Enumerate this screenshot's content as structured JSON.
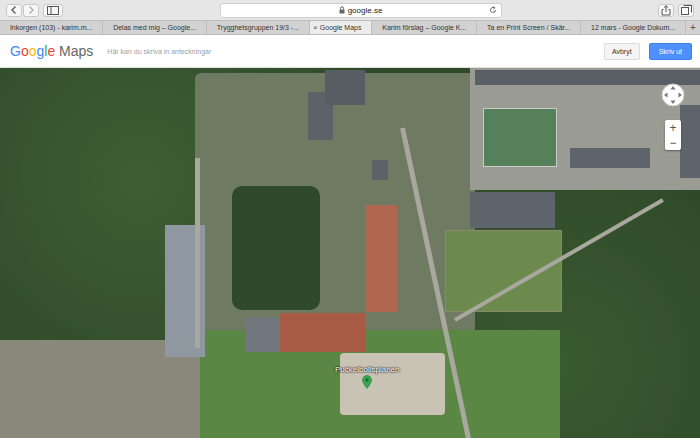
{
  "browser": {
    "url": "google.se",
    "secure": true
  },
  "tabs": [
    {
      "label": "Inkorgen (103) - karim.m...",
      "selected": false
    },
    {
      "label": "Delas med mig – Google...",
      "selected": false
    },
    {
      "label": "Trygghetsgruppen 19/3 -...",
      "selected": false
    },
    {
      "label": "Google Maps",
      "selected": true
    },
    {
      "label": "Karim förslag – Google K...",
      "selected": false
    },
    {
      "label": "Ta en Print Screen / Skär...",
      "selected": false
    },
    {
      "label": "12 mars - Google Dokum...",
      "selected": false
    }
  ],
  "tab_close": "×",
  "new_tab": "+",
  "maps_header": {
    "logo": "Google Maps",
    "note_placeholder": "Här kan du skriva in anteckningar",
    "buttons": [
      {
        "label": "Avbryt",
        "kind": "secondary"
      },
      {
        "label": "Skriv ut",
        "kind": "primary"
      }
    ]
  },
  "map": {
    "place_label": "Puckelbollsplanen",
    "zoom_in": "+",
    "zoom_out": "−"
  }
}
